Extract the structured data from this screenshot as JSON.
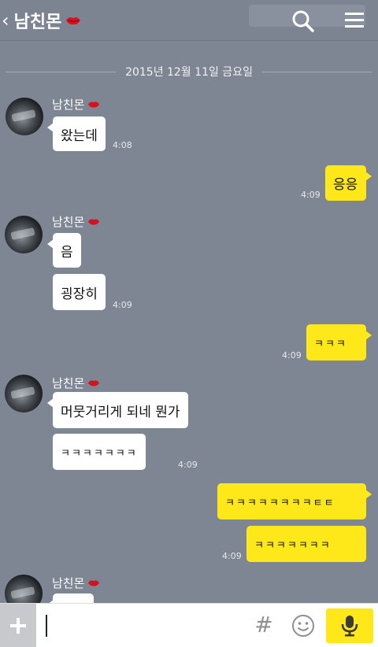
{
  "header": {
    "back_icon": "chevron-left-icon",
    "title": "남친몬",
    "search_icon": "search-icon",
    "menu_icon": "menu-icon"
  },
  "date_separator": "2015년 12월 11일 금요일",
  "colors": {
    "background": "#7e8694",
    "my_bubble": "#ffe81a",
    "their_bubble": "#ffffff",
    "heart_lips": "#d81020"
  },
  "messages": [
    {
      "sender": "남친몬",
      "text": "왔는데",
      "time": "4:08"
    },
    {
      "sender": "me",
      "text": "응응",
      "time": "4:09"
    },
    {
      "sender": "남친몬",
      "text": "음",
      "time": ""
    },
    {
      "sender": "남친몬",
      "text": "굉장히",
      "time": "4:09"
    },
    {
      "sender": "me",
      "text": "ㅋㅋㅋ",
      "time": "4:09"
    },
    {
      "sender": "남친몬",
      "text": "머뭇거리게 되네 뭔가",
      "time": ""
    },
    {
      "sender": "남친몬",
      "text": "ㅋㅋㅋㅋㅋㅋㅋ",
      "time": "4:09"
    },
    {
      "sender": "me",
      "text": "ㅋㅋㅋㅋㅋㅋㅋㅋㅌㅌ",
      "time": ""
    },
    {
      "sender": "me",
      "text": "ㅋㅋㅋㅋㅋㅋㅋ",
      "time": "4:09"
    }
  ],
  "sender_names": [
    "남친몬",
    "남친몬",
    "남친몬",
    "남친몬"
  ],
  "input_bar": {
    "plus_icon": "plus-icon",
    "hash_label": "#",
    "emoji_icon": "smiley-icon",
    "mic_icon": "microphone-icon",
    "input_value": ""
  }
}
